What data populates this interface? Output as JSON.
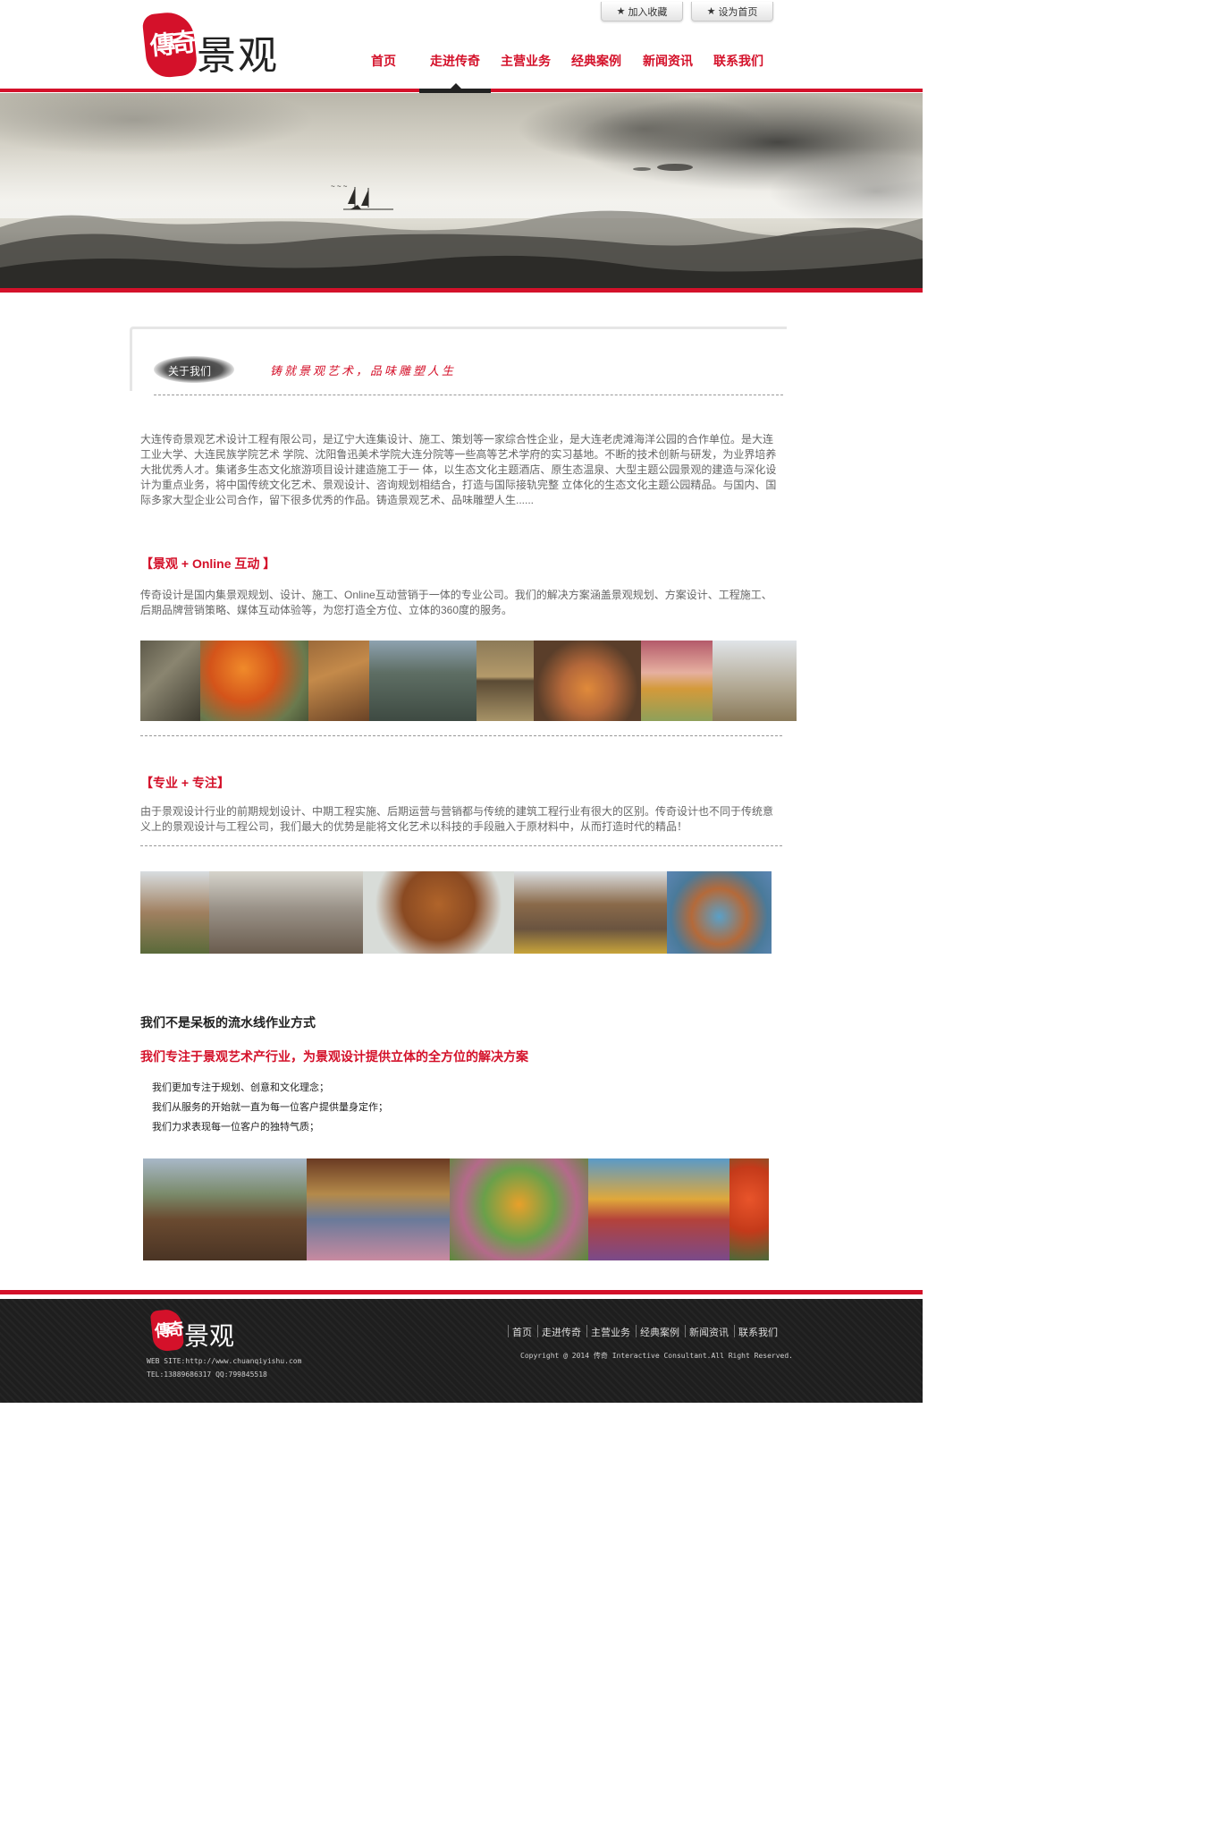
{
  "header": {
    "logo_text": "景观",
    "logo_seal": "傳奇",
    "fav_label": "加入收藏",
    "home_label": "设为首页",
    "nav": [
      "首页",
      "走进传奇",
      "主营业务",
      "经典案例",
      "新闻资讯",
      "联系我们"
    ],
    "active_nav": "走进传奇"
  },
  "about": {
    "badge": "关于我们",
    "slogan": "铸就景观艺术，品味雕塑人生",
    "intro": "大连传奇景观艺术设计工程有限公司，是辽宁大连集设计、施工、策划等一家综合性企业，是大连老虎滩海洋公园的合作单位。是大连工业大学、大连民族学院艺术 学院、沈阳鲁迅美术学院大连分院等一些高等艺术学府的实习基地。不断的技术创新与研发，为业界培养大批优秀人才。集诸多生态文化旅游项目设计建造施工于一 体，以生态文化主题酒店、原生态温泉、大型主题公园景观的建造与深化设计为重点业务，将中国传统文化艺术、景观设计、咨询规划相结合，打造与国际接轨完整 立体化的生态文化主题公园精品。与国内、国际多家大型企业公司合作，留下很多优秀的作品。铸造景观艺术、品味雕塑人生......"
  },
  "online": {
    "title": "【景观 + Online 互动 】",
    "text": "传奇设计是国内集景观规划、设计、施工、Online互动营销于一体的专业公司。我们的解决方案涵盖景观规划、方案设计、工程施工、后期品牌营销策略、媒体互动体验等，为您打造全方位、立体的360度的服务。"
  },
  "pro": {
    "title": "【专业 + 专注】",
    "text": "由于景观设计行业的前期规划设计、中期工程实施、后期运营与营销都与传统的建筑工程行业有很大的区别。传奇设计也不同于传统意义上的景观设计与工程公司，我们最大的优势是能将文化艺术以科技的手段融入于原材料中，从而打造时代的精品！"
  },
  "approach": {
    "title": "我们不是呆板的流水线作业方式",
    "subtitle": "我们专注于景观艺术产行业，为景观设计提供立体的全方位的解决方案",
    "bullets": [
      "我们更加专注于规划、创意和文化理念；",
      "我们从服务的开始就一直为每一位客户提供量身定作；",
      "我们力求表现每一位客户的独特气质；"
    ]
  },
  "footer": {
    "logo_text": "景观",
    "logo_seal": "傳奇",
    "website": "WEB SITE:http://www.chuanqiyishu.com",
    "contact": "TEL:13889686317 QQ:799845518",
    "nav": [
      "首页",
      "走进传奇",
      "主营业务",
      "经典案例",
      "新闻资讯",
      "联系我们"
    ],
    "copyright": "Copyright @ 2014 传奇 Interactive Consultant.All Right Reserved."
  },
  "colors": {
    "brand_red": "#d4112a",
    "footer_bg": "#1e1e1e"
  }
}
